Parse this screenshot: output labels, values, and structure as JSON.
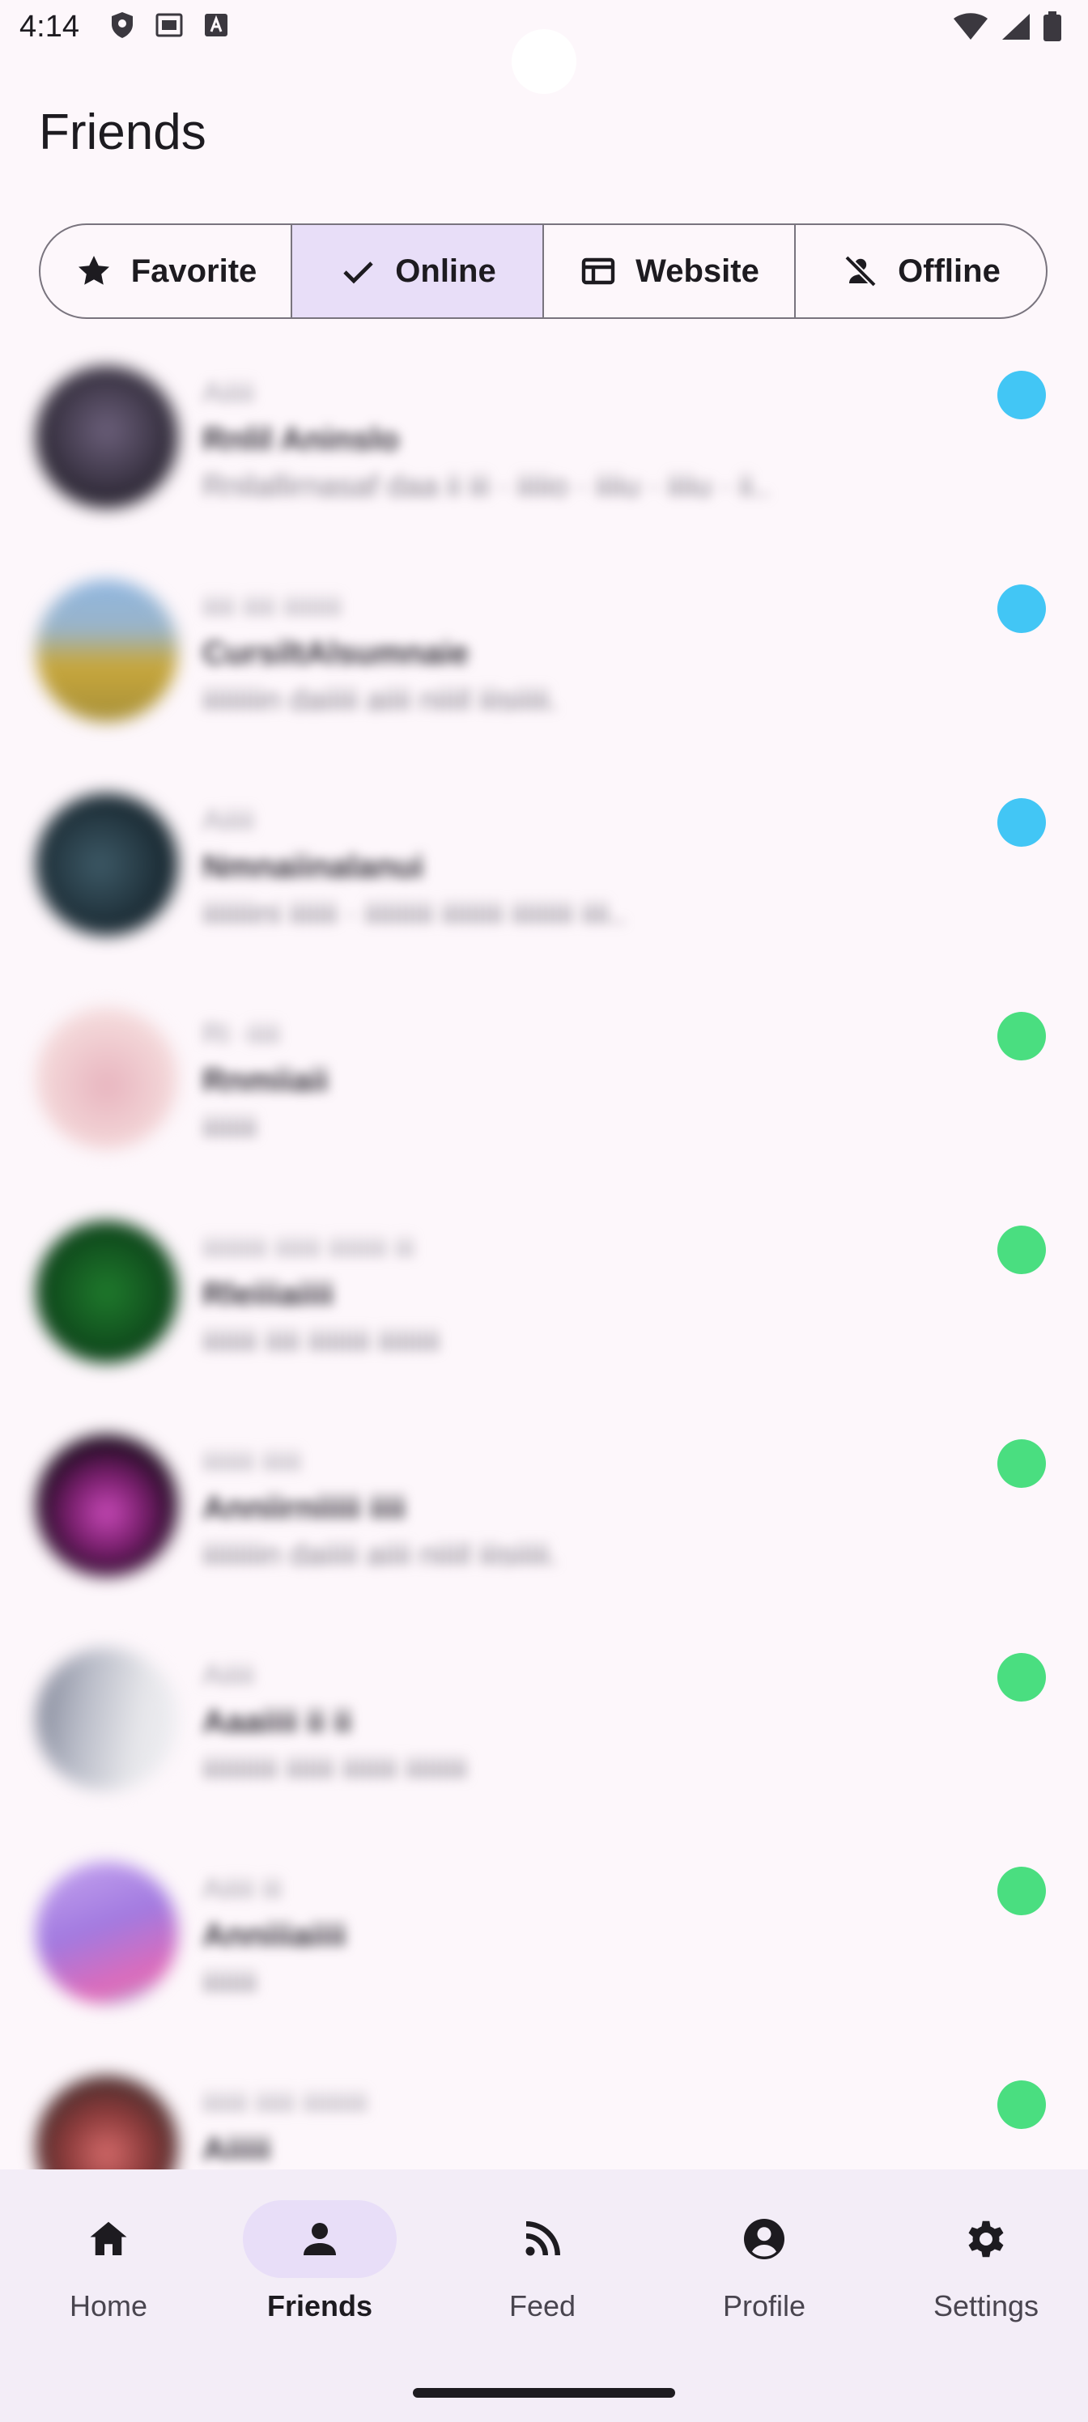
{
  "status_bar": {
    "time": "4:14"
  },
  "header": {
    "title": "Friends"
  },
  "filters": [
    {
      "label": "Favorite",
      "icon": "star-icon",
      "selected": false
    },
    {
      "label": "Online",
      "icon": "check-icon",
      "selected": true
    },
    {
      "label": "Website",
      "icon": "web-icon",
      "selected": false
    },
    {
      "label": "Offline",
      "icon": "person-off-icon",
      "selected": false
    }
  ],
  "friends": [
    {
      "line1": "Aiiiii",
      "line2": "Rnlil Aninslo",
      "line3": "Rnilallirnasaf daa ii iii · iiiiio · iiiiu · iiiiu · ii..",
      "status_color": "#42c6f5",
      "avatar_colors": [
        "#2b2633",
        "#6b5f7a"
      ]
    },
    {
      "line1": "iiiii iiiii iiiiiiiii",
      "line2": "CursiltAlsumnaie",
      "line3": "iiiiiiiiin daiiiii aiiii niiiil iiisiiiii.",
      "status_color": "#42c6f5",
      "avatar_colors": [
        "#c8a73c",
        "#8fb6e0"
      ]
    },
    {
      "line1": "Aiiiii",
      "line2": "Nmnaiinalanui",
      "line3": "iiiiiiiini iiiiiii · iiiiiiiiii iiiiiiiii iiiiiiiii iiii..",
      "status_color": "#42c6f5",
      "avatar_colors": [
        "#1a2a33",
        "#3d5966"
      ]
    },
    {
      "line1": "Ri ·iiiii",
      "line2": "Rnmiiaii",
      "line3": "iiiiiiii",
      "status_color": "#4ade80",
      "avatar_colors": [
        "#f3d6d8",
        "#e8b5bf"
      ]
    },
    {
      "line1": "iiiiiiiiii iiiiiii iiiiiiiii iii",
      "line2": "Rleiiiaiiii",
      "line3": "iiiiiiii iiiii iiiiiiiii iiiiiiiii",
      "status_color": "#4ade80",
      "avatar_colors": [
        "#0f4a1c",
        "#1f7a2c"
      ]
    },
    {
      "line1": "iiiiiiii iiiiii",
      "line2": "Anniirniiiii iiii",
      "line3": "iiiiiiiiin daiiiii aiiii niiiil iiisiiiii.",
      "status_color": "#4ade80",
      "avatar_colors": [
        "#1a0a1c",
        "#7a1f6e"
      ]
    },
    {
      "line1": "Aiiiii",
      "line2": "Aaaiiii ii ii",
      "line3": "iiiiiiiiiii iiiiiii iiiiiiii iiiiiiiii",
      "status_color": "#4ade80",
      "avatar_colors": [
        "#e6e6ea",
        "#7f8496"
      ]
    },
    {
      "line1": "Aiiiii iii",
      "line2": "Anniiiaiiii",
      "line3": "iiiiiiii",
      "status_color": "#4ade80",
      "avatar_colors": [
        "#c6a6f0",
        "#e06ab8"
      ]
    },
    {
      "line1": "iiiiiii iiiiii iiiiiiiiii",
      "line2": "Aiiiii",
      "line3": "",
      "status_color": "#4ade80",
      "avatar_colors": [
        "#3b2a2a",
        "#d46a6a"
      ]
    }
  ],
  "bottom_nav": [
    {
      "label": "Home",
      "icon": "home-icon",
      "active": false
    },
    {
      "label": "Friends",
      "icon": "person-icon",
      "active": true
    },
    {
      "label": "Feed",
      "icon": "rss-icon",
      "active": false
    },
    {
      "label": "Profile",
      "icon": "account-circle-icon",
      "active": false
    },
    {
      "label": "Settings",
      "icon": "gear-icon",
      "active": false
    }
  ],
  "colors": {
    "background": "#fdf7fb",
    "selected_segment": "#e8def8",
    "nav_background": "#f3edf7",
    "status_online_web": "#42c6f5",
    "status_online": "#4ade80"
  }
}
